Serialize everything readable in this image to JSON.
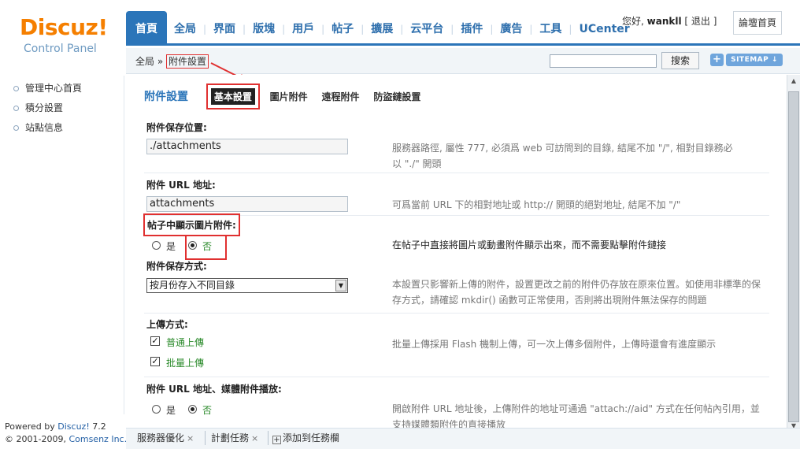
{
  "brand": {
    "logo": "Discuz!",
    "subtitle": "Control Panel"
  },
  "left_menu": {
    "items": [
      {
        "label": "管理中心首頁"
      },
      {
        "label": "積分設置"
      },
      {
        "label": "站點信息"
      }
    ]
  },
  "footer": {
    "powered_prefix": "Powered by",
    "powered_link": "Discuz!",
    "version": "7.2",
    "copyright_prefix": "© 2001-2009,",
    "copyright_link": "Comsenz Inc."
  },
  "nav": {
    "tabs": [
      {
        "label": "首頁",
        "active": true
      },
      {
        "label": "全局"
      },
      {
        "label": "界面"
      },
      {
        "label": "版塊"
      },
      {
        "label": "用戶"
      },
      {
        "label": "帖子"
      },
      {
        "label": "擴展"
      },
      {
        "label": "云平台"
      },
      {
        "label": "插件"
      },
      {
        "label": "廣告"
      },
      {
        "label": "工具"
      },
      {
        "label": "UCenter"
      }
    ],
    "greeting": "您好,",
    "username": "wankll",
    "logout_label": "[ 退出 ]",
    "forum_home_label": "論壇首頁"
  },
  "breadcrumb": {
    "root": "全局",
    "separator": "»",
    "current": "附件設置"
  },
  "search": {
    "placeholder": "",
    "button_label": "搜索"
  },
  "sitemap": {
    "plus_label": "+",
    "label": "SITEMAP ↓"
  },
  "subnav": {
    "title": "附件設置",
    "tabs": [
      {
        "label": "基本設置",
        "active": true
      },
      {
        "label": "圖片附件"
      },
      {
        "label": "遠程附件"
      },
      {
        "label": "防盜鏈設置"
      }
    ]
  },
  "settings": {
    "save_path": {
      "label": "附件保存位置:",
      "value": "./attachments",
      "desc_line1": "服務器路徑, 屬性 777, 必須爲 web 可訪問到的目錄, 結尾不加 \"/\", 相對目錄務必",
      "desc_line2": "以 \"./\" 開頭"
    },
    "url": {
      "label": "附件 URL 地址:",
      "value": "attachments",
      "desc": "可爲當前 URL 下的相對地址或 http:// 開頭的絕對地址, 結尾不加 \"/\""
    },
    "show_images": {
      "label": "帖子中顯示圖片附件:",
      "yes": "是",
      "no": "否",
      "selected": "no",
      "desc": "在帖子中直接將圖片或動畫附件顯示出來，而不需要點擊附件鏈接"
    },
    "save_method": {
      "label": "附件保存方式:",
      "value": "按月份存入不同目錄",
      "desc_line1": "本設置只影響新上傳的附件，設置更改之前的附件仍存放在原來位置。如使用非標準的保",
      "desc_line2": "存方式，請確認 mkdir() 函數可正常使用，否則將出現附件無法保存的問題"
    },
    "upload_method": {
      "label": "上傳方式:",
      "options": [
        {
          "label": "普通上傳",
          "checked": true
        },
        {
          "label": "批量上傳",
          "checked": true
        }
      ],
      "desc": "批量上傳採用 Flash 機制上傳，可一次上傳多個附件，上傳時還會有進度顯示"
    },
    "media_play": {
      "label": "附件 URL 地址、媒體附件播放:",
      "yes": "是",
      "no": "否",
      "selected": "no",
      "desc_line1": "開啟附件 URL 地址後，上傳附件的地址可通過 \"attach://aid\" 方式在任何帖內引用，並",
      "desc_line2": "支持媒體類附件的直接播放"
    }
  },
  "taskbar": {
    "items": [
      {
        "label": "服務器優化",
        "close": "×"
      },
      {
        "label": "計劃任務",
        "close": "×"
      }
    ],
    "add_label": "添加到任務欄"
  },
  "colors": {
    "accent": "#2b75b9",
    "logo": "#f57f00",
    "annotation": "#e03030",
    "green_label": "#2a8a2a"
  }
}
